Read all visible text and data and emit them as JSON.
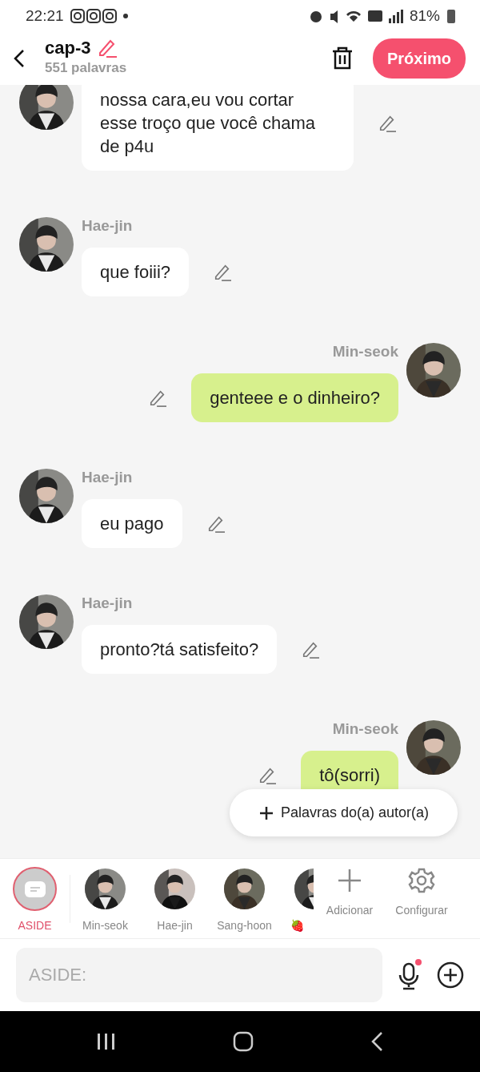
{
  "status_bar": {
    "time": "22:21",
    "battery": "81%"
  },
  "header": {
    "title": "cap-3",
    "subtitle": "551 palavras",
    "next_button": "Próximo"
  },
  "messages": [
    {
      "kind": "incoming",
      "text": "nossa cara,eu vou cortar esse troço que você chama de p4u"
    },
    {
      "kind": "incoming",
      "name": "Hae-jin",
      "text": "que foiii?"
    },
    {
      "kind": "outgoing",
      "name": "Min-seok",
      "text": "genteee e o dinheiro?"
    },
    {
      "kind": "incoming",
      "name": "Hae-jin",
      "text": "eu pago"
    },
    {
      "kind": "incoming",
      "name": "Hae-jin",
      "text": "pronto?tá satisfeito?"
    },
    {
      "kind": "outgoing",
      "name": "Min-seok",
      "text": "tô(sorri)"
    }
  ],
  "floating_button": "Palavras do(a) autor(a)",
  "characters": [
    {
      "kind": "aside",
      "label": "ASIDE",
      "selected": true
    },
    {
      "kind": "avatar",
      "label": "Min-seok",
      "selected": false
    },
    {
      "kind": "avatar",
      "label": "Hae-jin",
      "selected": false
    },
    {
      "kind": "avatar",
      "label": "Sang-hoon",
      "selected": false
    },
    {
      "kind": "partial",
      "label": "🍓",
      "selected": false
    }
  ],
  "actions": [
    {
      "kind": "add",
      "label": "Adicionar"
    },
    {
      "kind": "settings",
      "label": "Configurar"
    }
  ],
  "composer": {
    "placeholder": "ASIDE:"
  }
}
